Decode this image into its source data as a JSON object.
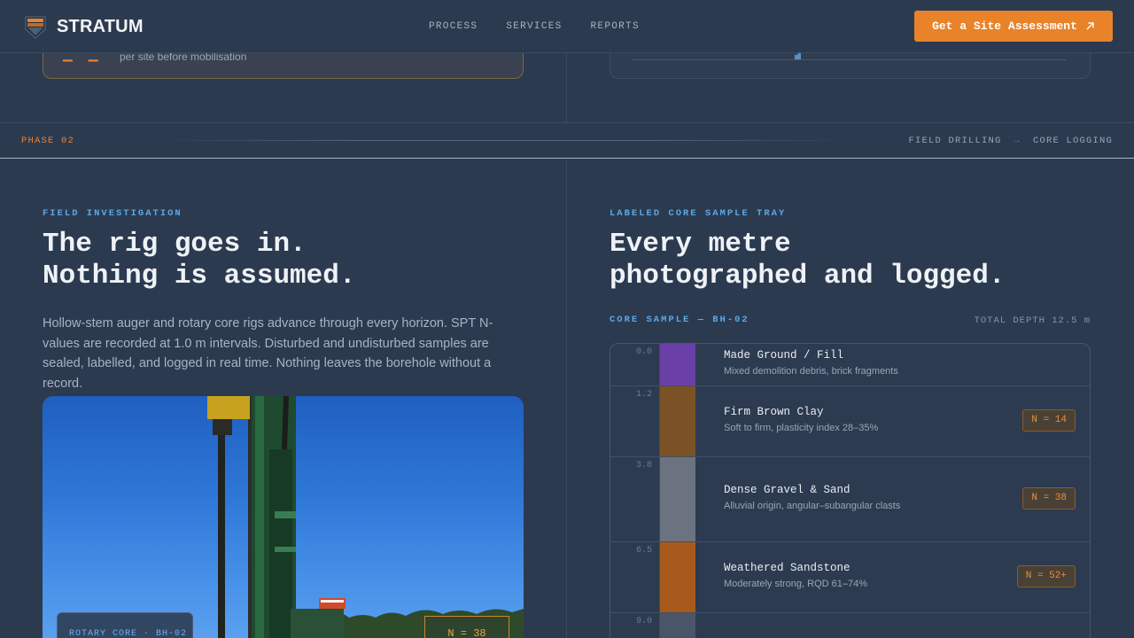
{
  "header": {
    "brand": "STRATUM",
    "nav": [
      "PROCESS",
      "SERVICES",
      "REPORTS"
    ],
    "cta_label": "Get a Site Assessment",
    "cta_icon": "arrow-up-right-icon"
  },
  "previous_section": {
    "left_card_text": "per site before mobilisation"
  },
  "phase_bar": {
    "label": "PHASE 02",
    "crumbs": [
      "FIELD DRILLING",
      "→",
      "CORE LOGGING"
    ]
  },
  "left": {
    "eyebrow": "FIELD INVESTIGATION",
    "headline_line1": "The rig goes in.",
    "headline_line2": "Nothing is assumed.",
    "lead": "Hollow-stem auger and rotary core rigs advance through every horizon. SPT N-values are recorded at 1.0 m intervals. Disturbed and undisturbed samples are sealed, labelled, and logged in real time. Nothing leaves the borehole without a record.",
    "photo_caption": "ROTARY CORE · BH-02",
    "photo_tag": "N = 38"
  },
  "right": {
    "eyebrow": "LABELED CORE SAMPLE TRAY",
    "headline_line1": "Every metre",
    "headline_line2": "photographed and logged.",
    "tray_title": "CORE SAMPLE — BH-02",
    "tray_total": "TOTAL DEPTH 12.5 m",
    "layers": [
      {
        "depth": "0.0",
        "name": "Made Ground / Fill",
        "desc": "Mixed demolition debris, brick fragments",
        "n": "",
        "color": "#6a3fa8"
      },
      {
        "depth": "1.2",
        "name": "Firm Brown Clay",
        "desc": "Soft to firm, plasticity index 28–35%",
        "n": "N = 14",
        "color": "#7a5226"
      },
      {
        "depth": "3.8",
        "name": "Dense Gravel & Sand",
        "desc": "Alluvial origin, angular–subangular clasts",
        "n": "N = 38",
        "color": "#6b7280"
      },
      {
        "depth": "6.5",
        "name": "Weathered Sandstone",
        "desc": "Moderately strong, RQD 61–74%",
        "n": "N = 52+",
        "color": "#a85a1c"
      },
      {
        "depth": "9.0",
        "name": "",
        "desc": "",
        "n": "",
        "color": "#4a5568"
      }
    ]
  },
  "colors": {
    "accent": "#e8832a",
    "eyebrow_blue": "#5aa8e6",
    "background": "#2c3a4f"
  }
}
